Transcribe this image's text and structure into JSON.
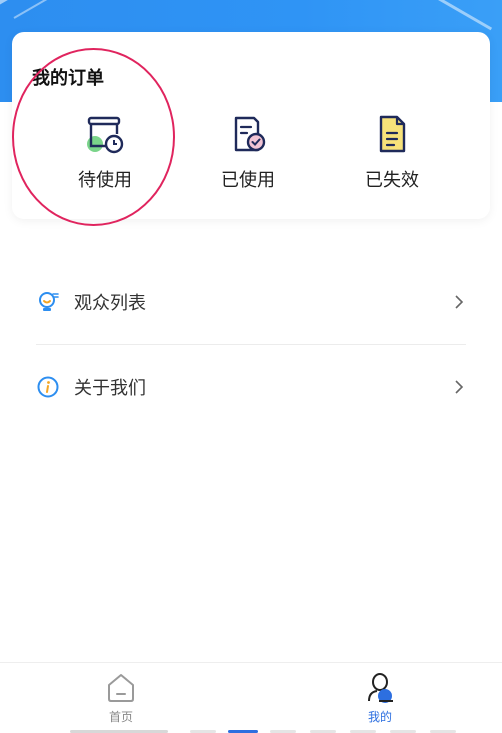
{
  "orders": {
    "title": "我的订单",
    "items": [
      {
        "label": "待使用",
        "icon": "pending-order-icon"
      },
      {
        "label": "已使用",
        "icon": "used-order-icon"
      },
      {
        "label": "已失效",
        "icon": "expired-order-icon"
      }
    ]
  },
  "menu": [
    {
      "label": "观众列表",
      "icon": "audience-icon"
    },
    {
      "label": "关于我们",
      "icon": "info-icon"
    }
  ],
  "tabbar": {
    "tabs": [
      {
        "label": "首页",
        "icon": "home-icon",
        "active": false
      },
      {
        "label": "我的",
        "icon": "profile-icon",
        "active": true
      }
    ]
  },
  "colors": {
    "brand_blue": "#2d8ef0",
    "active_tab": "#2d6fe0",
    "inactive_tab": "#888888",
    "highlight": "#e0245e"
  }
}
